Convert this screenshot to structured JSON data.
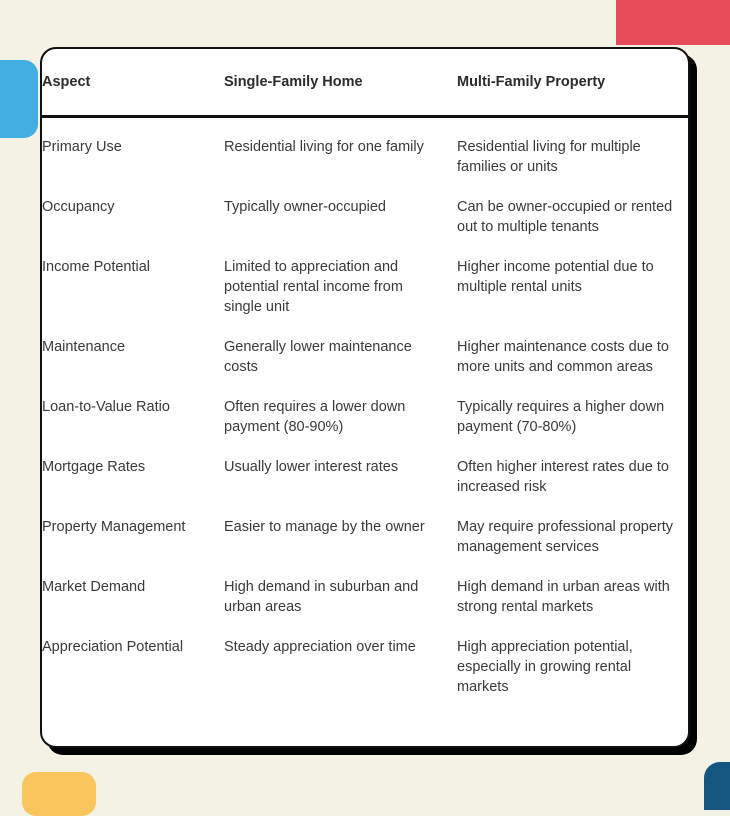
{
  "theme": {
    "page_background": "#F4F1E5",
    "card_background": "#FFFFFF",
    "card_border": "#111111",
    "heading_text": "#2B2B2B",
    "body_text": "#3A3A3A",
    "accent_red": "#E54B58",
    "accent_blue": "#42AEE2",
    "accent_yellow": "#FCC65E",
    "accent_navy": "#14567F"
  },
  "table": {
    "headers": [
      "Aspect",
      "Single-Family Home",
      "Multi-Family Property"
    ],
    "rows": [
      {
        "aspect": "Primary Use",
        "single_family": "Residential living for one family",
        "multi_family": "Residential living for multiple families or units"
      },
      {
        "aspect": "Occupancy",
        "single_family": "Typically owner-occupied",
        "multi_family": "Can be owner-occupied or rented out to multiple tenants"
      },
      {
        "aspect": "Income Potential",
        "single_family": "Limited to appreciation and potential rental income from single unit",
        "multi_family": "Higher income potential due to multiple rental units"
      },
      {
        "aspect": "Maintenance",
        "single_family": "Generally lower maintenance costs",
        "multi_family": "Higher maintenance costs due to more units and common areas"
      },
      {
        "aspect": "Loan-to-Value Ratio",
        "single_family": "Often requires a lower down payment (80-90%)",
        "multi_family": "Typically requires a higher down payment (70-80%)"
      },
      {
        "aspect": "Mortgage Rates",
        "single_family": "Usually lower interest rates",
        "multi_family": "Often higher interest rates due to increased risk"
      },
      {
        "aspect": "Property Management",
        "single_family": "Easier to manage by the owner",
        "multi_family": "May require professional property management services"
      },
      {
        "aspect": "Market Demand",
        "single_family": "High demand in suburban and urban areas",
        "multi_family": "High demand in urban areas with strong rental markets"
      },
      {
        "aspect": "Appreciation Potential",
        "single_family": "Steady appreciation over time",
        "multi_family": "High appreciation potential, especially in growing rental markets"
      }
    ]
  }
}
